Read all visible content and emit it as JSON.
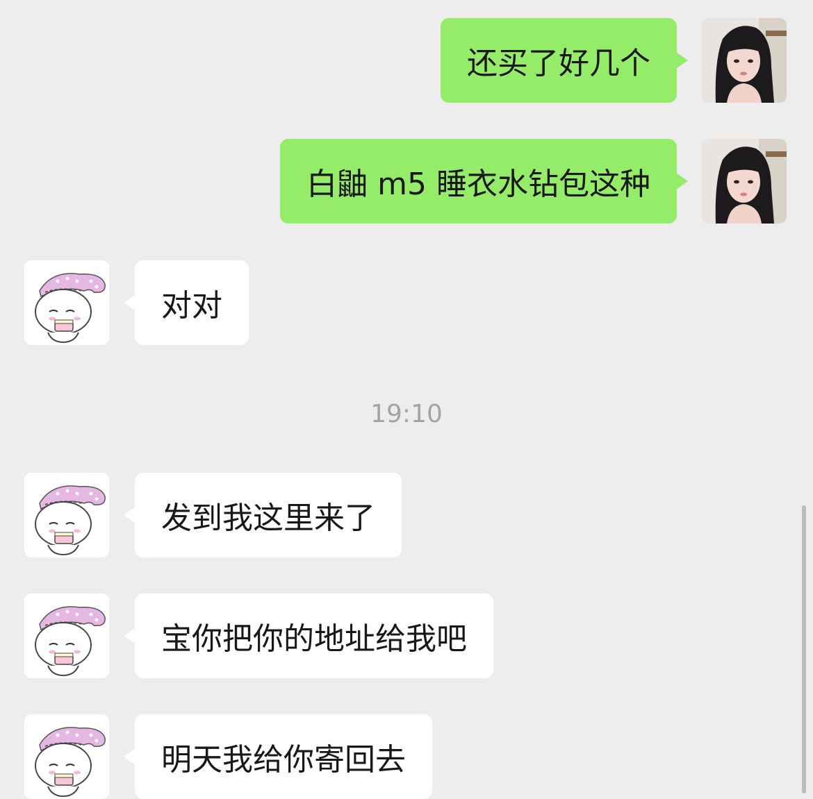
{
  "messages": [
    {
      "side": "sent",
      "text": "还买了好几个",
      "avatar": "girl-photo-avatar"
    },
    {
      "side": "sent",
      "text": "白鼬 m5 睡衣水钻包这种",
      "avatar": "girl-photo-avatar"
    },
    {
      "side": "recv",
      "text": "对对",
      "avatar": "pink-bunny-cartoon-avatar"
    },
    {
      "side": "recv",
      "text": "发到我这里来了",
      "avatar": "pink-bunny-cartoon-avatar"
    },
    {
      "side": "recv",
      "text": "宝你把你的地址给我吧",
      "avatar": "pink-bunny-cartoon-avatar"
    },
    {
      "side": "recv",
      "text": "明天我给你寄回去",
      "avatar": "pink-bunny-cartoon-avatar"
    }
  ],
  "timestamp": "19:10",
  "colors": {
    "background": "#ededed",
    "sent_bubble": "#95ec69",
    "recv_bubble": "#ffffff",
    "timestamp_text": "#a3a3a3"
  }
}
